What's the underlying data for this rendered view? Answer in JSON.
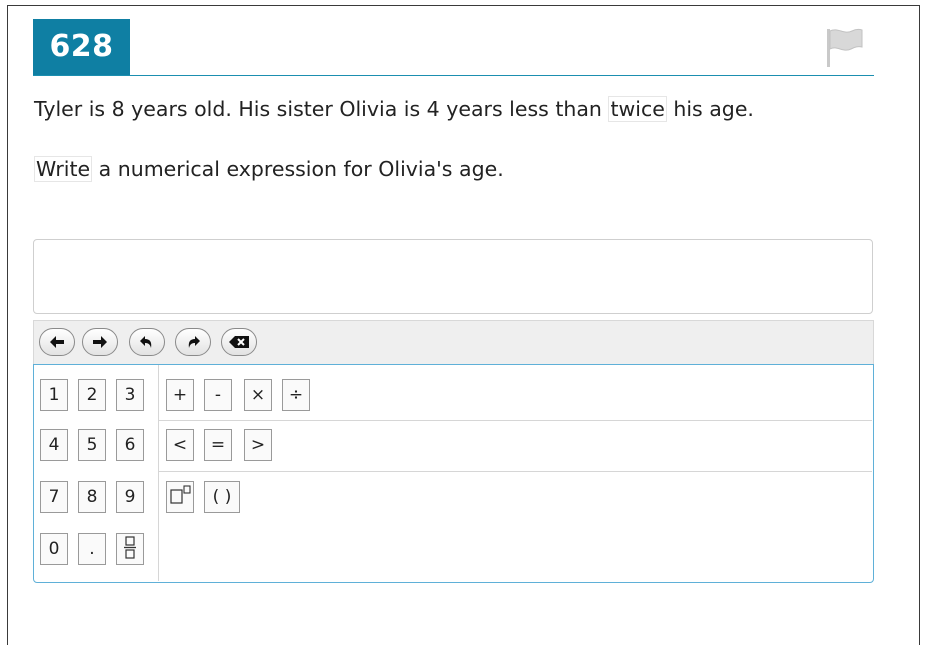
{
  "question": {
    "number": "628",
    "text1": {
      "before": "Tyler is 8 years old. His sister Olivia is 4 years less than ",
      "highlight": "twice",
      "after": " his age."
    },
    "text2": {
      "highlight": "Write",
      "after": " a numerical expression for Olivia's age."
    }
  },
  "answer": {
    "value": ""
  },
  "navbar": {
    "buttons": [
      "arrow-left-icon",
      "arrow-right-icon",
      "undo-icon",
      "redo-icon",
      "backspace-icon"
    ]
  },
  "keypad": {
    "digits": [
      "1",
      "2",
      "3",
      "4",
      "5",
      "6",
      "7",
      "8",
      "9",
      "0",
      "."
    ],
    "operators": {
      "plus": "+",
      "minus": "-",
      "times": "×",
      "divide": "÷"
    },
    "comparisons": {
      "less": "<",
      "equal": "=",
      "greater": ">"
    },
    "parens": "( )",
    "special_icons": [
      "exponent-icon",
      "fraction-icon"
    ]
  },
  "colors": {
    "accent": "#0f7fa3",
    "keypad_border": "#5fb0d8",
    "flag": "#d0d0d0"
  }
}
